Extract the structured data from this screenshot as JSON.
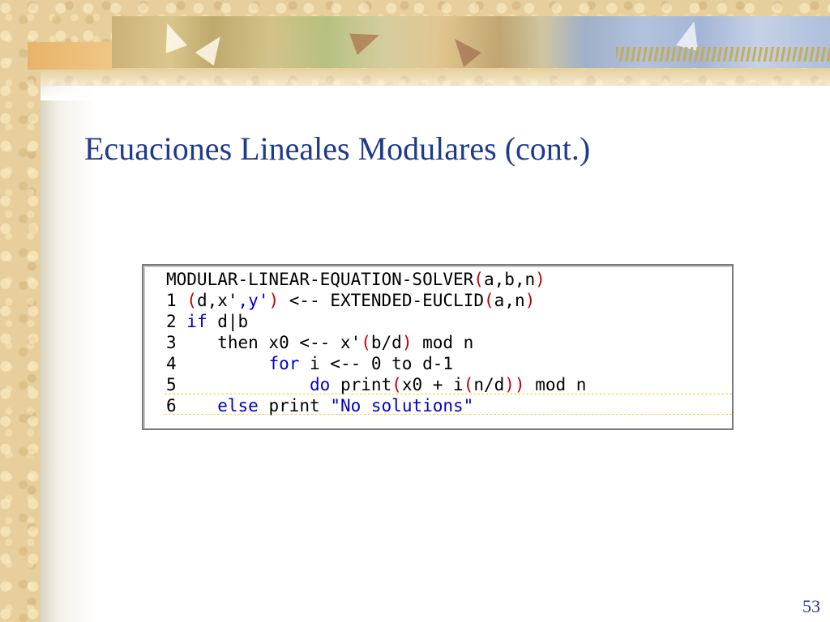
{
  "slide": {
    "title": "Ecuaciones Lineales Modulares (cont.)",
    "page_number": "53",
    "title_color": "#1e3a8a"
  },
  "code": {
    "highlighted_line": 7,
    "lines": [
      [
        {
          "t": "MODULAR-LINEAR-EQUATION-SOLVER"
        },
        {
          "t": "(",
          "c": "pr"
        },
        {
          "t": "a,b,n"
        },
        {
          "t": ")",
          "c": "pr"
        }
      ],
      [
        {
          "t": "1 "
        },
        {
          "t": "(",
          "c": "pr"
        },
        {
          "t": "d,x'"
        },
        {
          "t": ",y'",
          "c": "kw"
        },
        {
          "t": ")",
          "c": "pr"
        },
        {
          "t": " <-- EXTENDED-EUCLID"
        },
        {
          "t": "(",
          "c": "pr"
        },
        {
          "t": "a,n"
        },
        {
          "t": ")",
          "c": "pr"
        }
      ],
      [
        {
          "t": "2 "
        },
        {
          "t": "if",
          "c": "kw"
        },
        {
          "t": " d|b"
        }
      ],
      [
        {
          "t": "3    then x0 <-- x'"
        },
        {
          "t": "(",
          "c": "pr"
        },
        {
          "t": "b/d"
        },
        {
          "t": ")",
          "c": "pr"
        },
        {
          "t": " mod n"
        }
      ],
      [
        {
          "t": "4         "
        },
        {
          "t": "for",
          "c": "kw"
        },
        {
          "t": " i <-- 0 to d-1"
        }
      ],
      [
        {
          "t": "5             "
        },
        {
          "t": "do",
          "c": "kw"
        },
        {
          "t": " print"
        },
        {
          "t": "(",
          "c": "pr"
        },
        {
          "t": "x0 + i"
        },
        {
          "t": "(",
          "c": "pr"
        },
        {
          "t": "n/d"
        },
        {
          "t": "))",
          "c": "pr"
        },
        {
          "t": " mod n"
        }
      ],
      [
        {
          "t": "6    "
        },
        {
          "t": "else",
          "c": "kw"
        },
        {
          "t": " print "
        },
        {
          "t": "\"No solutions\"",
          "c": "st"
        }
      ]
    ]
  }
}
